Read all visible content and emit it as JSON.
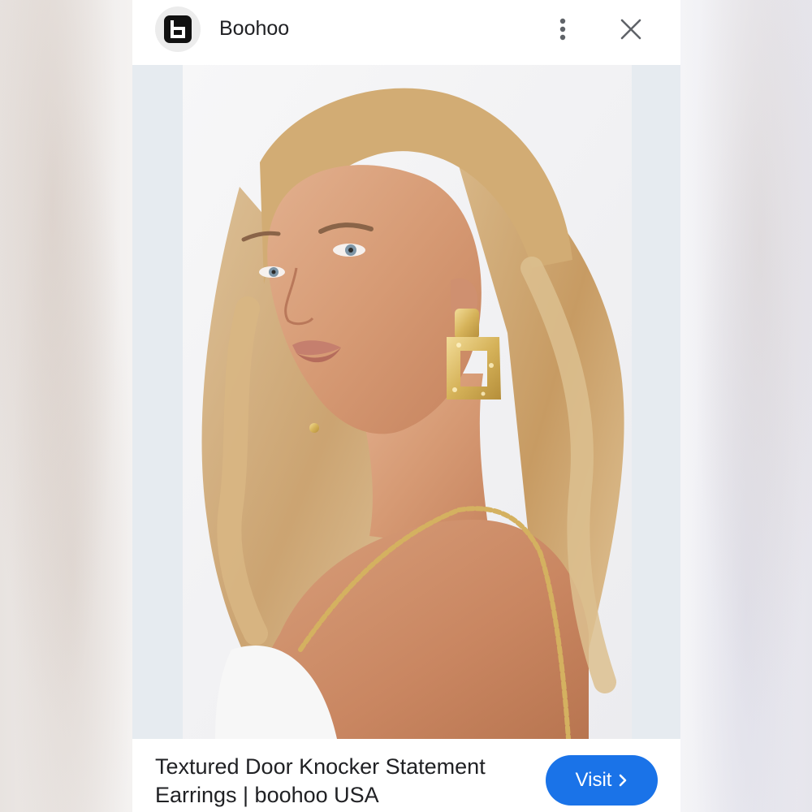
{
  "header": {
    "site_name": "Boohoo",
    "logo_letter": "b",
    "more_icon": "more-vert-icon",
    "close_icon": "close-icon"
  },
  "image": {
    "subject": "product-photo"
  },
  "footer": {
    "title": "Textured Door Knocker Statement Earrings | boohoo USA",
    "visit_label": "Visit",
    "visit_icon": "chevron-right-icon"
  },
  "colors": {
    "accent": "#1a73e8",
    "text": "#202124",
    "icon": "#5f6368"
  }
}
